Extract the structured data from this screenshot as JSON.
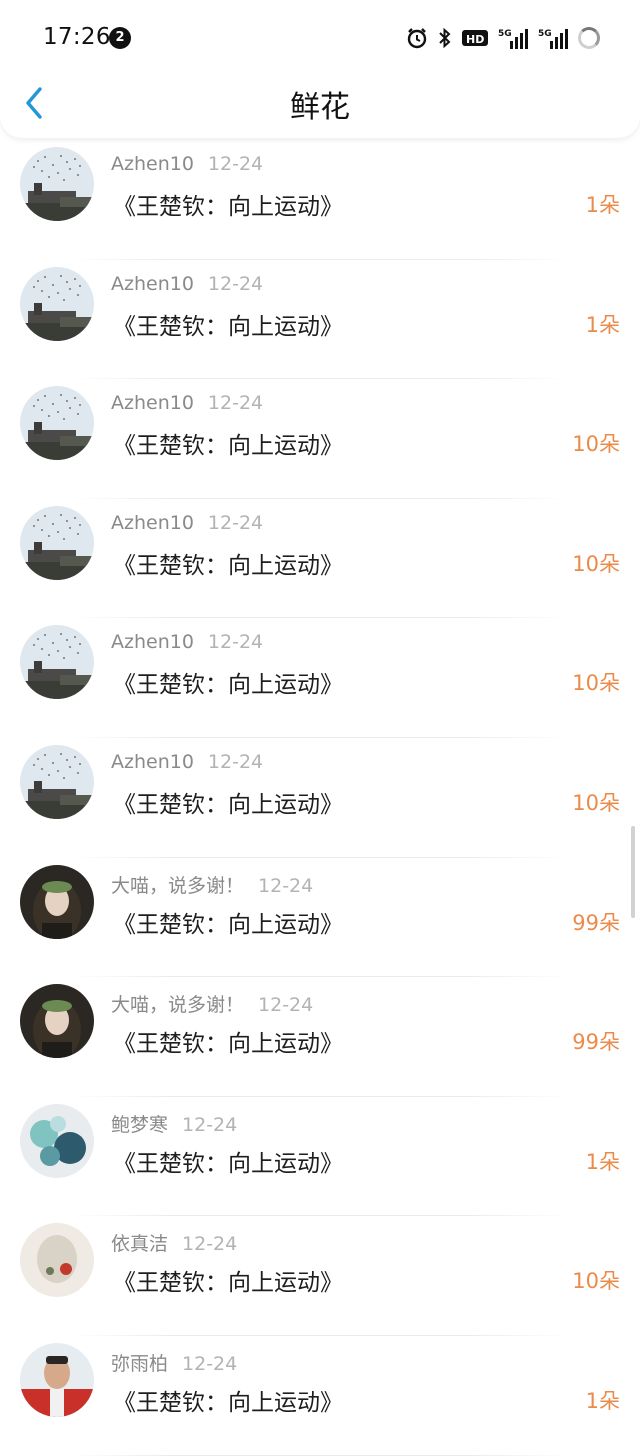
{
  "status_bar": {
    "time": "17:26",
    "notification_count": "2",
    "icons": [
      "alarm-icon",
      "bluetooth-icon",
      "hd-icon",
      "5g-signal-icon",
      "5g-signal-icon",
      "loading-icon"
    ]
  },
  "header": {
    "title": "鲜花",
    "back_icon": "chevron-left-icon",
    "back_color": "#2196d8"
  },
  "colors": {
    "count": "#ea8b4a",
    "username": "#8a8a8a",
    "date": "#b3b3b3"
  },
  "items": [
    {
      "user": "Azhen10",
      "date": "12-24",
      "book": "《王楚钦：向上运动》",
      "count": "1朵",
      "avatar": "sky"
    },
    {
      "user": "Azhen10",
      "date": "12-24",
      "book": "《王楚钦：向上运动》",
      "count": "1朵",
      "avatar": "sky"
    },
    {
      "user": "Azhen10",
      "date": "12-24",
      "book": "《王楚钦：向上运动》",
      "count": "10朵",
      "avatar": "sky"
    },
    {
      "user": "Azhen10",
      "date": "12-24",
      "book": "《王楚钦：向上运动》",
      "count": "10朵",
      "avatar": "sky"
    },
    {
      "user": "Azhen10",
      "date": "12-24",
      "book": "《王楚钦：向上运动》",
      "count": "10朵",
      "avatar": "sky"
    },
    {
      "user": "Azhen10",
      "date": "12-24",
      "book": "《王楚钦：向上运动》",
      "count": "10朵",
      "avatar": "sky"
    },
    {
      "user": "大喵，说多谢！",
      "date": "12-24",
      "book": "《王楚钦：向上运动》",
      "count": "99朵",
      "avatar": "girl"
    },
    {
      "user": "大喵，说多谢！",
      "date": "12-24",
      "book": "《王楚钦：向上运动》",
      "count": "99朵",
      "avatar": "girl"
    },
    {
      "user": "鲍梦寒",
      "date": "12-24",
      "book": "《王楚钦：向上运动》",
      "count": "1朵",
      "avatar": "flower"
    },
    {
      "user": "依真洁",
      "date": "12-24",
      "book": "《王楚钦：向上运动》",
      "count": "10朵",
      "avatar": "white"
    },
    {
      "user": "弥雨柏",
      "date": "12-24",
      "book": "《王楚钦：向上运动》",
      "count": "1朵",
      "avatar": "man"
    }
  ]
}
